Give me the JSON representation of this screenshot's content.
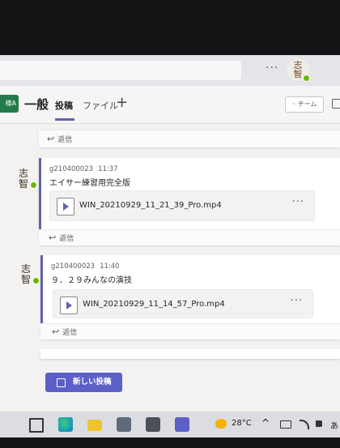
{
  "header": {
    "avatar_text_1": "志",
    "avatar_text_2": "智",
    "more_label": "···"
  },
  "channel": {
    "team_tile": "様A",
    "name": "一般",
    "tabs": [
      {
        "label": "投稿",
        "active": true
      },
      {
        "label": "ファイル",
        "active": false
      }
    ],
    "add_tab": "+",
    "team_button": "◦ チーム"
  },
  "feed": {
    "reply_label": "返信",
    "reply_arrow": "↩",
    "posts": [
      {
        "avatar_line1": "志",
        "avatar_line2": "智",
        "author": "g210400023",
        "time": "11:37",
        "message": "エイサー練習用完全版",
        "attachment": "WIN_20210929_11_21_39_Pro.mp4",
        "more": "···"
      },
      {
        "avatar_line1": "志",
        "avatar_line2": "智",
        "author": "g210400023",
        "time": "11:40",
        "message": "９．２９みんなの演技",
        "attachment": "WIN_20210929_11_14_57_Pro.mp4",
        "more": "···"
      }
    ],
    "new_post_label": "新しい投稿"
  },
  "taskbar": {
    "temperature": "28°C",
    "ime_label": "あ",
    "chevron": "^"
  },
  "colors": {
    "accent": "#6264a7",
    "presence": "#6bb700",
    "team_tile": "#237b4b"
  }
}
